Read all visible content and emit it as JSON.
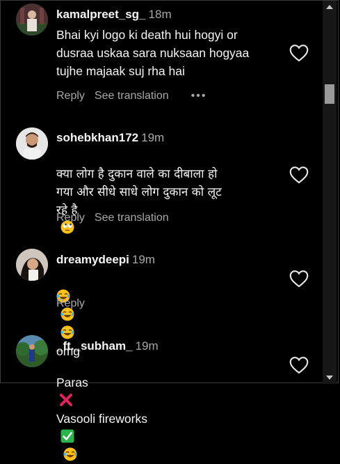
{
  "comments": [
    {
      "username": "kamalpreet_sg_",
      "time": "18m",
      "text": "Bhai kyi logo ki death hui hogyi or\ndusraa uskaa sara nuksaan hogyaa\ntujhe majaak suj rha hai",
      "reply": "Reply",
      "translate": "See translation",
      "more": "•••"
    },
    {
      "username": "sohebkhan172",
      "time": "19m",
      "text": "क्या लोग है दुकान वाले का दीबाला हो\nगया और सीधे साधे लोग दुकान को लूट\nरहे है",
      "reply": "Reply",
      "translate": "See translation"
    },
    {
      "username": "dreamydeepi",
      "time": "19m",
      "text_suffix": "omg",
      "reply": "Reply"
    },
    {
      "username": "_ft._subham_",
      "time": "19m",
      "text_part1": "Paras",
      "text_part2": "Vasooli fireworks"
    }
  ],
  "icons": {
    "heart": "heart-outline-icon",
    "laugh": "face-with-tears-of-joy-emoji",
    "rolling_eyes": "face-with-rolling-eyes-emoji",
    "cross": "cross-mark-emoji",
    "check": "check-mark-button-emoji"
  },
  "colors": {
    "background": "#000000",
    "text": "#f5f5f5",
    "secondary": "#a8a8a8",
    "cross": "#e0245e",
    "check": "#2bb24c"
  }
}
